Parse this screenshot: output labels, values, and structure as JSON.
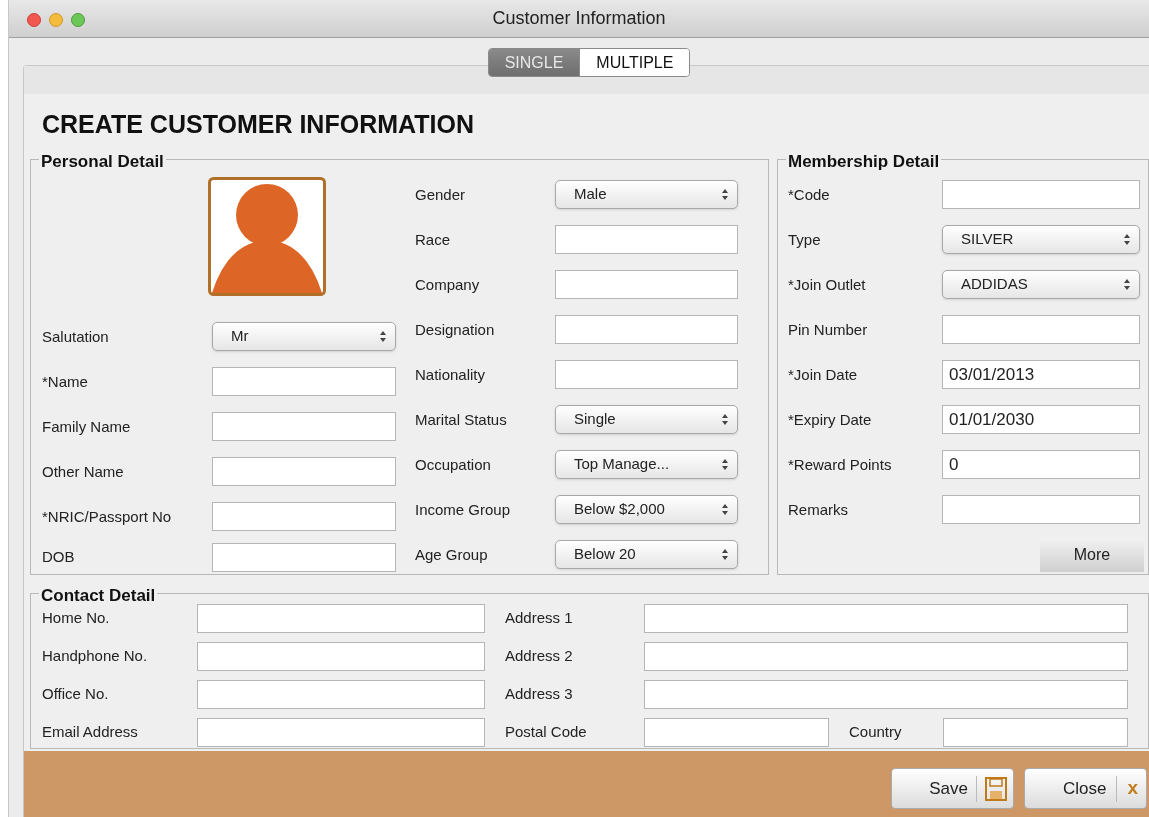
{
  "window": {
    "title": "Customer Information"
  },
  "tabs": [
    {
      "label": "SINGLE",
      "selected": true
    },
    {
      "label": "MULTIPLE",
      "selected": false
    }
  ],
  "heading": "CREATE CUSTOMER INFORMATION",
  "personal_detail": {
    "title": "Personal Detail",
    "left_fields": [
      {
        "label": "Salutation",
        "kind": "select",
        "value": "Mr"
      },
      {
        "label": "*Name",
        "kind": "text"
      },
      {
        "label": "Family Name",
        "kind": "text"
      },
      {
        "label": "Other Name",
        "kind": "text"
      },
      {
        "label": "*NRIC/Passport No",
        "kind": "text"
      },
      {
        "label": "DOB",
        "kind": "text"
      }
    ],
    "right_fields": [
      {
        "label": "Gender",
        "kind": "select",
        "value": "Male"
      },
      {
        "label": "Race",
        "kind": "text"
      },
      {
        "label": "Company",
        "kind": "text"
      },
      {
        "label": "Designation",
        "kind": "text"
      },
      {
        "label": "Nationality",
        "kind": "text"
      },
      {
        "label": "Marital Status",
        "kind": "select",
        "value": "Single"
      },
      {
        "label": "Occupation",
        "kind": "select",
        "value": "Top Manage..."
      },
      {
        "label": "Income Group",
        "kind": "select",
        "value": "Below $2,000"
      },
      {
        "label": "Age Group",
        "kind": "select",
        "value": "Below 20"
      }
    ]
  },
  "membership_detail": {
    "title": "Membership Detail",
    "fields": [
      {
        "label": "*Code",
        "kind": "text"
      },
      {
        "label": "Type",
        "kind": "select",
        "value": "SILVER"
      },
      {
        "label": "*Join Outlet",
        "kind": "select",
        "value": "ADDIDAS"
      },
      {
        "label": "Pin Number",
        "kind": "text"
      },
      {
        "label": "*Join Date",
        "kind": "text",
        "value": "03/01/2013"
      },
      {
        "label": "*Expiry Date",
        "kind": "text",
        "value": "01/01/2030"
      },
      {
        "label": "*Reward Points",
        "kind": "text",
        "value": "0"
      },
      {
        "label": "Remarks",
        "kind": "text"
      }
    ],
    "more_button": "More"
  },
  "contact_detail": {
    "title": "Contact Detail",
    "left_fields": [
      {
        "label": "Home No."
      },
      {
        "label": "Handphone No."
      },
      {
        "label": "Office No."
      },
      {
        "label": "Email Address"
      }
    ],
    "right_fields": [
      {
        "label": "Address 1"
      },
      {
        "label": "Address 2"
      },
      {
        "label": "Address 3"
      }
    ],
    "postal_code": {
      "label": "Postal Code"
    },
    "country": {
      "label": "Country"
    }
  },
  "footer": {
    "save_button": "Save",
    "close_button": "Close",
    "close_glyph": "x"
  }
}
